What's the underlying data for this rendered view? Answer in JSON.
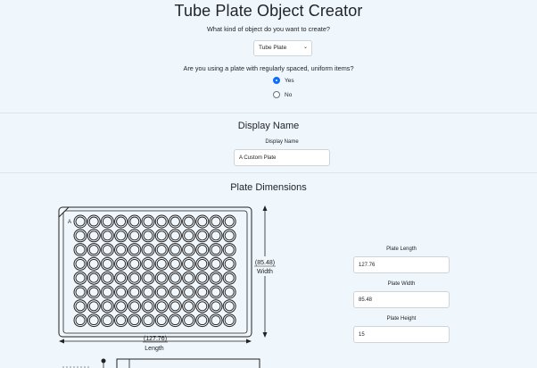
{
  "header": {
    "title": "Tube Plate Object Creator"
  },
  "object_type": {
    "question": "What kind of object do you want to create?",
    "selected": "Tube Plate"
  },
  "uniform": {
    "question": "Are you using a plate with regularly spaced, uniform items?",
    "options": [
      {
        "label": "Yes",
        "checked": true
      },
      {
        "label": "No",
        "checked": false
      }
    ]
  },
  "display_name": {
    "section_title": "Display Name",
    "field_label": "Display Name",
    "value": "A Custom Plate"
  },
  "plate_dimensions": {
    "section_title": "Plate Dimensions",
    "diagram": {
      "row_label": "A",
      "width_value": "(85.48)",
      "width_label": "Width",
      "length_value": "(127.76)",
      "length_label": "Length"
    },
    "fields": [
      {
        "label": "Plate Length",
        "value": "127.76"
      },
      {
        "label": "Plate Width",
        "value": "85.48"
      },
      {
        "label": "Plate Height",
        "value": "15"
      }
    ]
  },
  "colors": {
    "background": "#f0f7fc",
    "accent": "#0d6efd"
  }
}
